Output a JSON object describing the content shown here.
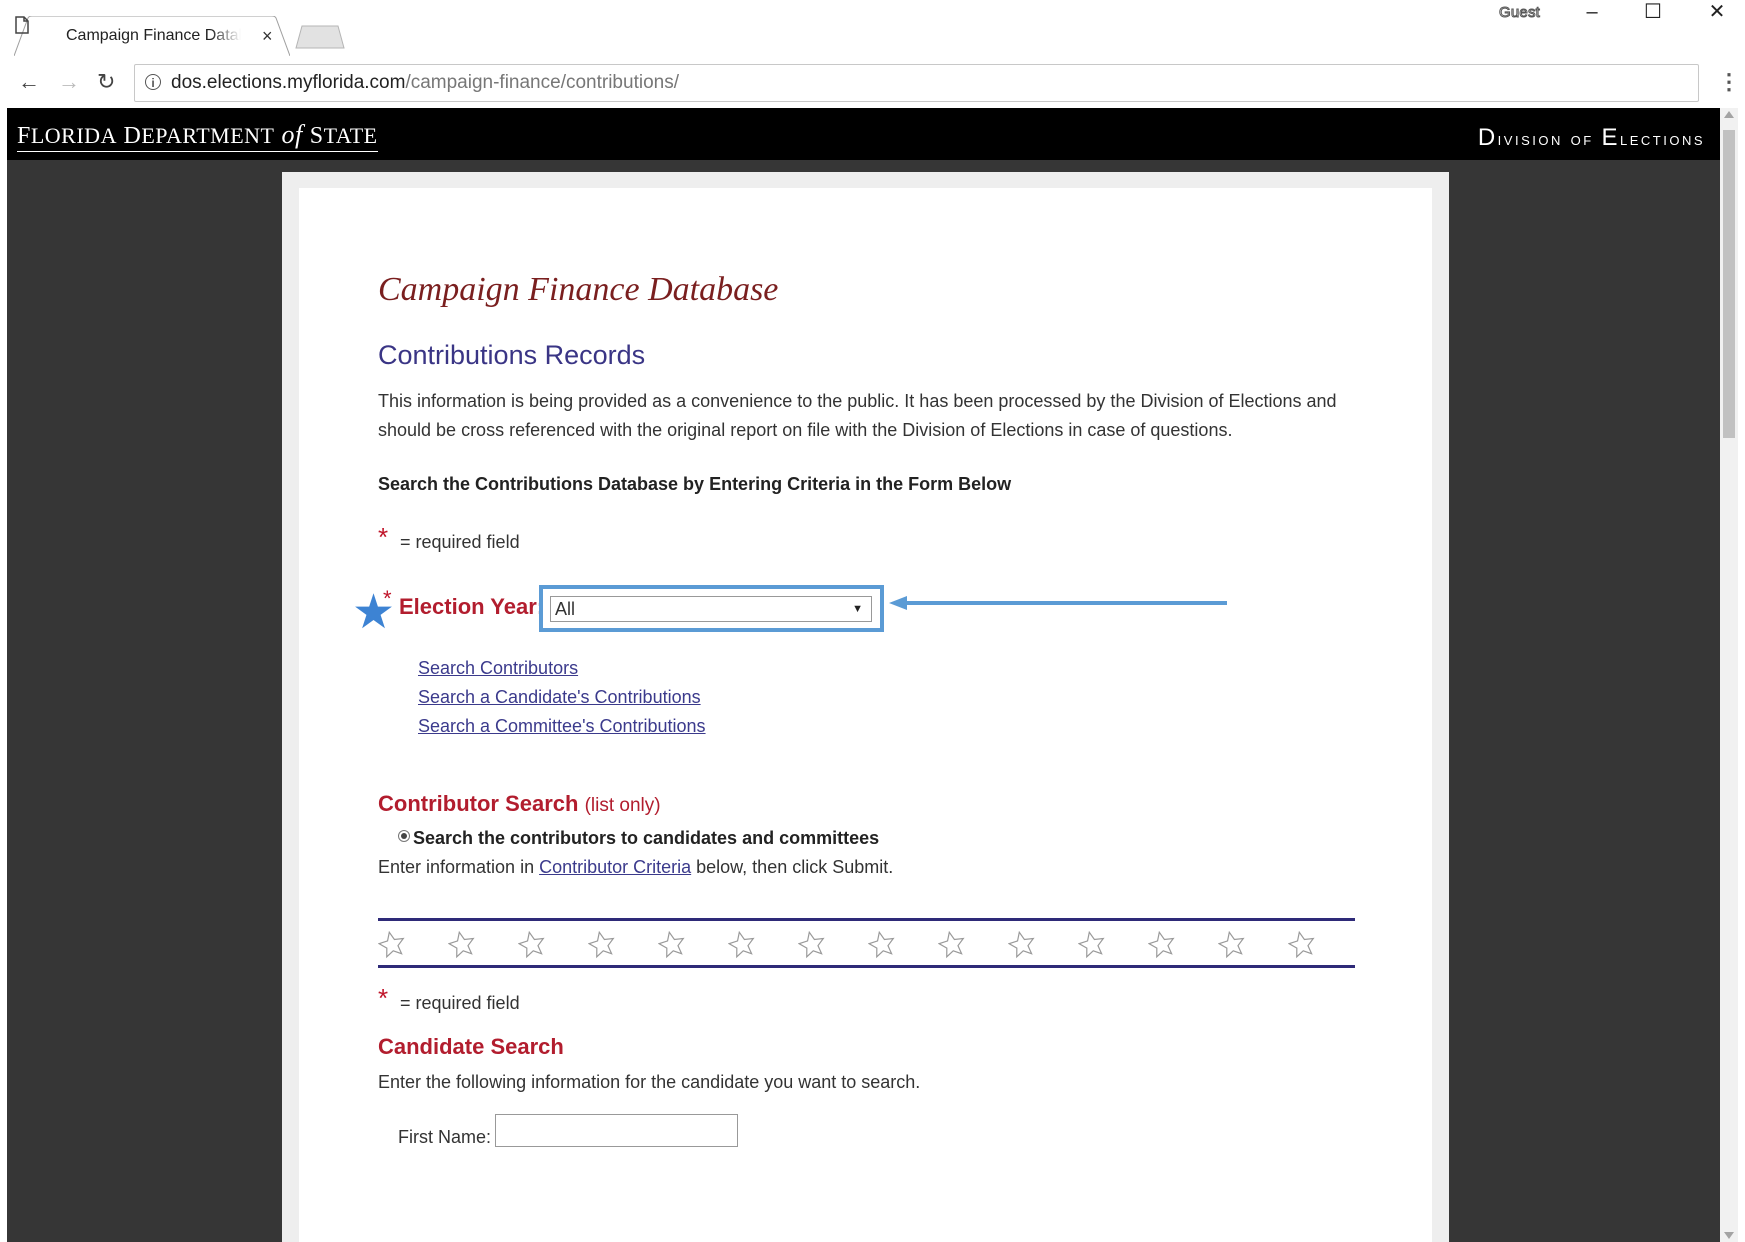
{
  "browser": {
    "tab_title": "Campaign Finance Datab",
    "tab_close": "×",
    "profile_label": "Guest",
    "window_controls": {
      "minimize": "–",
      "maximize": "☐",
      "close": "✕"
    },
    "nav": {
      "back": "←",
      "forward": "→",
      "reload": "↻",
      "menu": "⋮"
    },
    "url_host": "dos.elections.myflorida.com",
    "url_path": "/campaign-finance/contributions/",
    "info_icon": "i"
  },
  "banner": {
    "left": {
      "f": "F",
      "lorida": "LORIDA",
      "d": " D",
      "epartment": "EPARTMENT",
      "of": " of ",
      "s": "S",
      "tate": "TATE"
    },
    "right": {
      "d": "D",
      "ivision": "ivision of ",
      "e": "E",
      "lections": "lections"
    }
  },
  "page": {
    "title": "Campaign Finance Database",
    "subtitle": "Contributions Records",
    "intro": "This information is being provided as a convenience to the public. It has been processed by the Division of Elections and should be cross referenced with the original report on file with the Division of Elections in case of questions.",
    "search_heading": "Search the Contributions Database by Entering Criteria in the Form Below",
    "required_star": "*",
    "required_text": "= required field",
    "election_year": {
      "star_big": "★",
      "req_star": "*",
      "label": "Election Year:",
      "selected": "All",
      "caret": "▼"
    },
    "links": {
      "contributors": "Search Contributors",
      "candidate": "Search a Candidate's Contributions",
      "committee": "Search a Committee's Contributions"
    },
    "contributor_search": {
      "heading": "Contributor Search",
      "sub": "(list only)",
      "radio_label": "Search the contributors to candidates and committees",
      "instr_before": "Enter information in ",
      "instr_link": "Contributor Criteria",
      "instr_after": " below, then click Submit."
    },
    "candidate_search": {
      "heading": "Candidate Search",
      "instr": "Enter the following information for the candidate you want to search.",
      "first_name_label": "First Name:",
      "first_name_value": ""
    }
  },
  "colors": {
    "accent_red": "#b21d2e",
    "link_blue": "#3b3a8c",
    "highlight_blue": "#5b9bd5",
    "navy_rule": "#2e2a78"
  }
}
